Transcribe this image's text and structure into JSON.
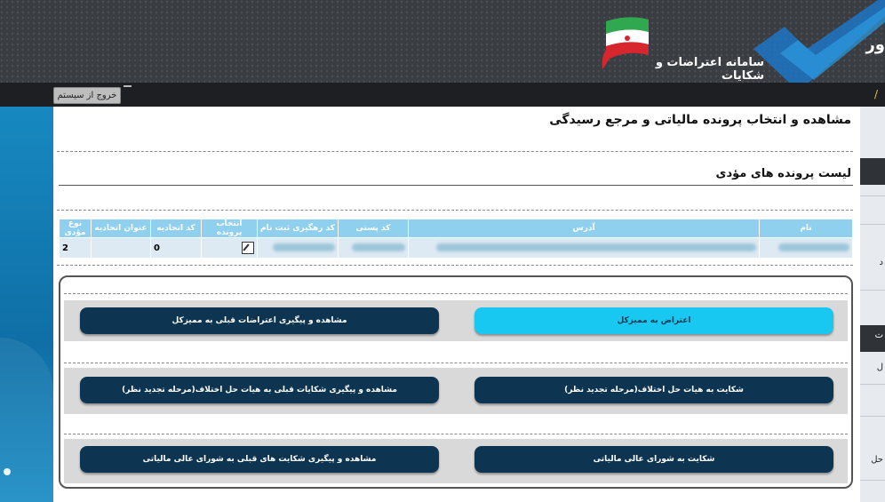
{
  "header": {
    "app_title": "سامانه اعتراضات و شکایات",
    "brand_fragment": "ور",
    "colors": {
      "header_bg": "#3a3d42",
      "accent_blue": "#19c8f0",
      "button_dark": "#0d3551"
    }
  },
  "navbar": {
    "logout_label": "خروج از سیستم",
    "glyph": "/"
  },
  "page": {
    "title": "مشاهده و انتخاب پرونده مالیاتی و مرجع رسیدگی",
    "section_title": "لیست پرونده های مؤدی"
  },
  "table": {
    "columns": [
      "نام",
      "آدرس",
      "کد پستی",
      "کد رهگیری ثبت نام",
      "انتخاب پرونده",
      "کد اتحادیه",
      "عنوان اتحادیه",
      "نوع مؤدی"
    ],
    "rows": [
      {
        "name": "",
        "address": "",
        "postal_code": "",
        "tracking_code": "",
        "select": "edit-icon",
        "union_code": "0",
        "union_title": "",
        "taxpayer_type": "2"
      }
    ]
  },
  "actions": {
    "row1": {
      "right": "اعتراض به ممیزکل",
      "left": "مشاهده و پیگیری اعتراضات قبلی به ممیزکل"
    },
    "row2": {
      "right": "شکایت به هیات حل اختلاف(مرحله تجدید نظر)",
      "left": "مشاهده و پیگیری شکایات قبلی به هیات حل اختلاف(مرحله تجدید نظر)"
    },
    "row3": {
      "right": "شکایت به شورای عالی مالیاتی",
      "left": "مشاهده و پیگیری شکایت های قبلی به شورای عالی مالیاتی"
    }
  },
  "right_panel": {
    "items": [
      "د",
      "ت",
      "ل",
      "حل"
    ]
  }
}
